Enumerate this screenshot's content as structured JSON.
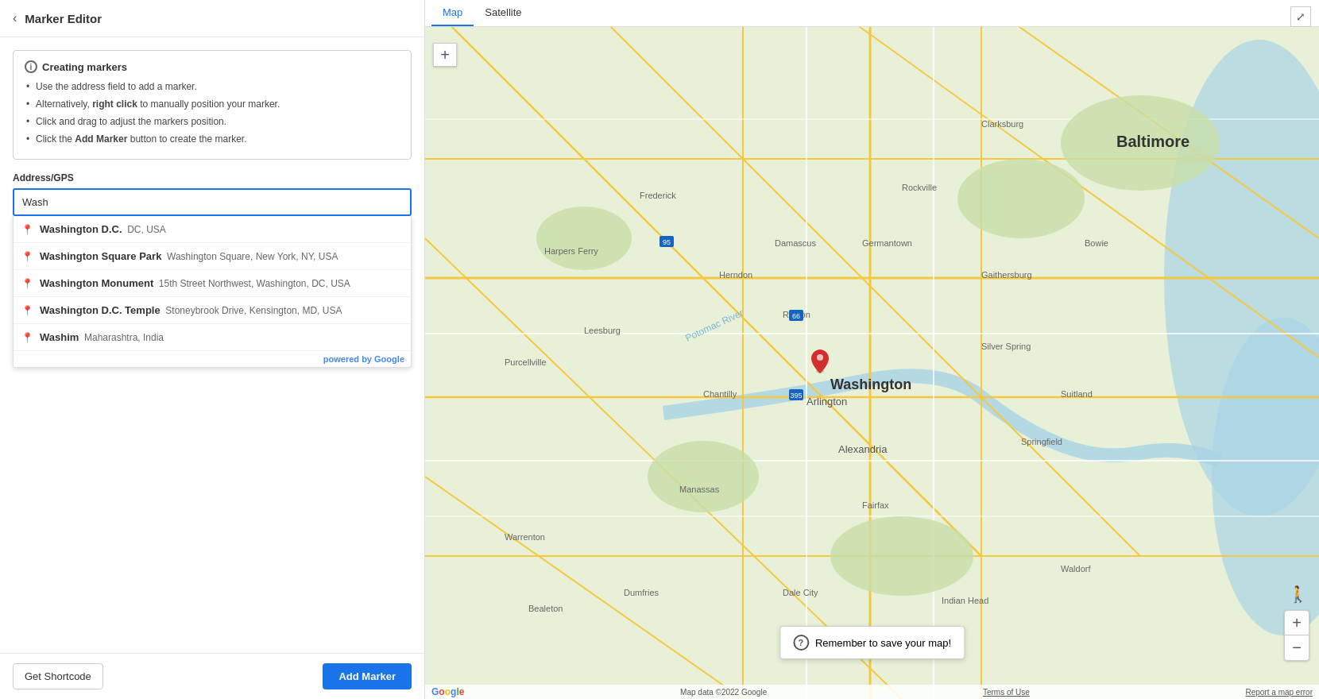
{
  "header": {
    "back_label": "‹",
    "title": "Marker Editor"
  },
  "info_box": {
    "title": "Creating markers",
    "items": [
      "Use the address field to add a marker.",
      "Alternatively, <b>right click</b> to manually position your marker.",
      "Click and drag to adjust the markers position.",
      "Click the <b>Add Marker</b> button to create the marker."
    ]
  },
  "address_label": "Address/GPS",
  "address_input_value": "Wash",
  "autocomplete": [
    {
      "main": "Washington D.C.",
      "sub": "DC, USA"
    },
    {
      "main": "Washington Square Park",
      "sub": "Washington Square, New York, NY, USA"
    },
    {
      "main": "Washington Monument",
      "sub": "15th Street Northwest, Washington, DC, USA"
    },
    {
      "main": "Washington D.C. Temple",
      "sub": "Stoneybrook Drive, Kensington, MD, USA"
    },
    {
      "main": "Washim",
      "sub": "Maharashtra, India"
    }
  ],
  "powered_by": "powered by",
  "footer": {
    "get_shortcode_label": "Get Shortcode",
    "add_marker_label": "Add Marker"
  },
  "map": {
    "tab_map": "Map",
    "tab_satellite": "Satellite",
    "save_reminder": "Remember to save your map!",
    "copyright": "Map data ©2022 Google",
    "terms": "Terms of Use",
    "report": "Report a map error"
  }
}
